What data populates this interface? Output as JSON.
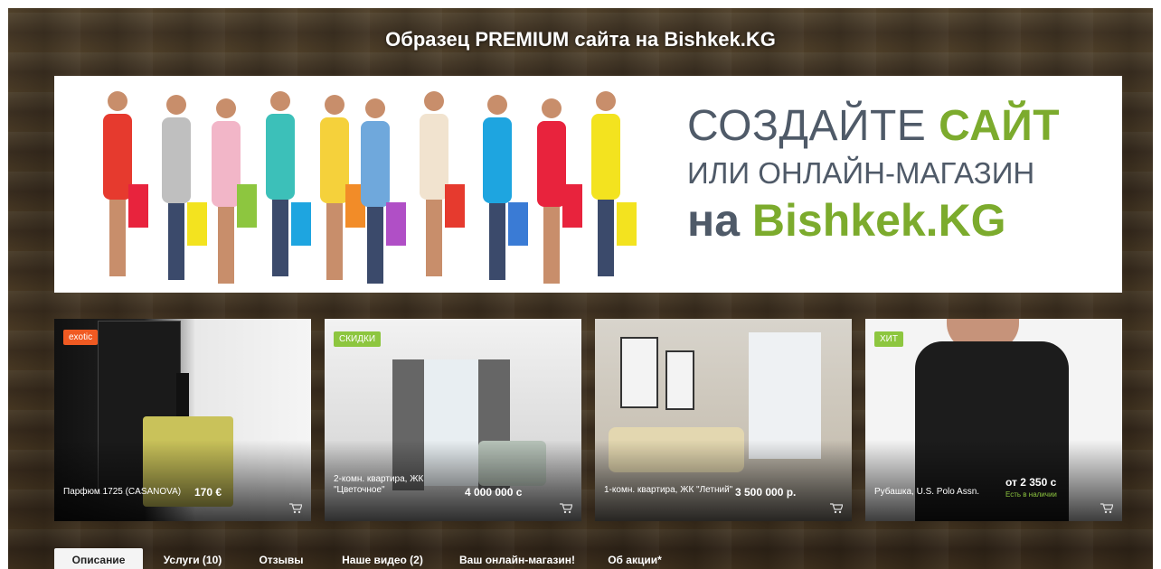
{
  "header": {
    "title": "Образец PREMIUM сайта на Bishkek.KG"
  },
  "banner": {
    "line1_a": "СОЗДАЙТЕ ",
    "line1_b": "САЙТ",
    "line2": "ИЛИ ОНЛАЙН-МАГАЗИН",
    "line3_a": "на ",
    "line3_b": "Bishkek.KG",
    "colors": {
      "gray": "#4f5a68",
      "green": "#7cab2d"
    }
  },
  "products": [
    {
      "tag": "exotic",
      "tag_color": "#f05a22",
      "name": "Парфюм 1725 (CASANOVA)",
      "price": "170 €",
      "stock": ""
    },
    {
      "tag": "СКИДКИ",
      "tag_color": "#8dc63f",
      "name": "2-комн. квартира, ЖК \"Цветочное\"",
      "price": "4 000 000 с",
      "stock": ""
    },
    {
      "tag": "",
      "tag_color": "",
      "name": "1-комн. квартира, ЖК \"Летний\"",
      "price": "3 500 000 р.",
      "stock": ""
    },
    {
      "tag": "ХИТ",
      "tag_color": "#8dc63f",
      "name": "Рубашка, U.S. Polo Assn.",
      "price": "от 2 350 с",
      "stock": "Есть в наличии"
    }
  ],
  "tabs": [
    {
      "label": "Описание",
      "active": true
    },
    {
      "label": "Услуги (10)",
      "active": false
    },
    {
      "label": "Отзывы",
      "active": false
    },
    {
      "label": "Наше видео (2)",
      "active": false
    },
    {
      "label": "Ваш онлайн-магазин!",
      "active": false
    },
    {
      "label": "Об акции*",
      "active": false
    }
  ],
  "icons": {
    "cart": "cart-icon"
  }
}
